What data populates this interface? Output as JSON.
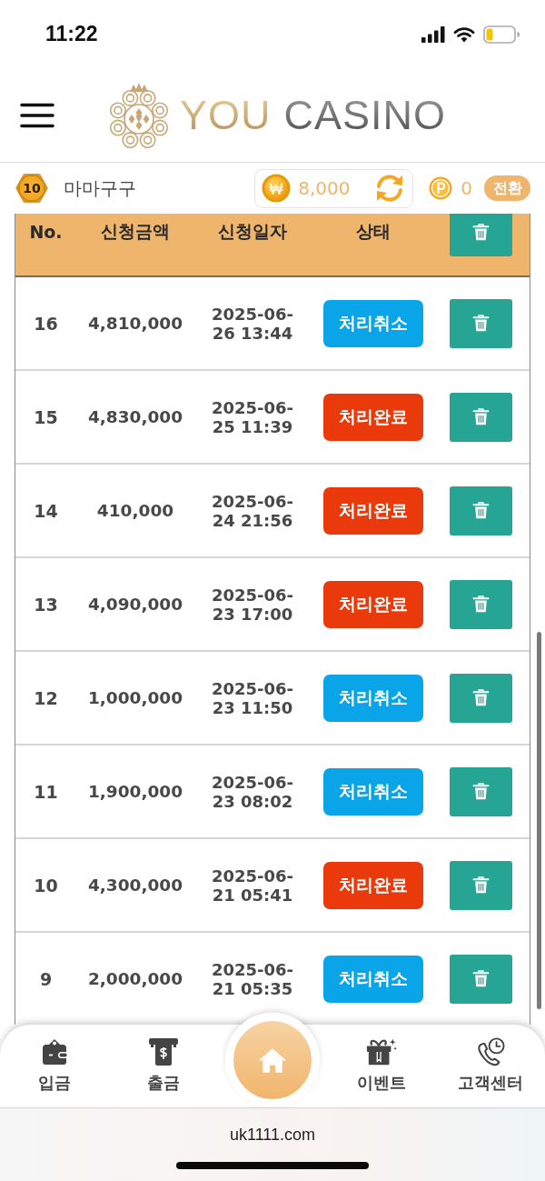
{
  "status_bar": {
    "time": "11:22"
  },
  "header": {
    "logo": {
      "primary": "YOU",
      "secondary": "CASINO"
    }
  },
  "user_bar": {
    "level": "10",
    "username": "마마구구",
    "balance": "8,000",
    "points": "0",
    "convert_button": "전환"
  },
  "table": {
    "columns": [
      "No.",
      "신청금액",
      "신청일자",
      "상태"
    ],
    "rows": [
      {
        "no": "16",
        "amount": "4,810,000",
        "date": "2025-06-26 13:44",
        "status": {
          "label": "처리취소",
          "kind": "cancelled"
        }
      },
      {
        "no": "15",
        "amount": "4,830,000",
        "date": "2025-06-25 11:39",
        "status": {
          "label": "처리완료",
          "kind": "completed"
        }
      },
      {
        "no": "14",
        "amount": "410,000",
        "date": "2025-06-24 21:56",
        "status": {
          "label": "처리완료",
          "kind": "completed"
        }
      },
      {
        "no": "13",
        "amount": "4,090,000",
        "date": "2025-06-23 17:00",
        "status": {
          "label": "처리완료",
          "kind": "completed"
        }
      },
      {
        "no": "12",
        "amount": "1,000,000",
        "date": "2025-06-23 11:50",
        "status": {
          "label": "처리취소",
          "kind": "cancelled"
        }
      },
      {
        "no": "11",
        "amount": "1,900,000",
        "date": "2025-06-23 08:02",
        "status": {
          "label": "처리취소",
          "kind": "cancelled"
        }
      },
      {
        "no": "10",
        "amount": "4,300,000",
        "date": "2025-06-21 05:41",
        "status": {
          "label": "처리완료",
          "kind": "completed"
        }
      },
      {
        "no": "9",
        "amount": "2,000,000",
        "date": "2025-06-21 05:35",
        "status": {
          "label": "처리취소",
          "kind": "cancelled"
        }
      }
    ]
  },
  "bottom_nav": {
    "items": [
      {
        "kind": "wallet",
        "label": "입금"
      },
      {
        "kind": "withdraw",
        "label": "출금"
      },
      {
        "kind": "home"
      },
      {
        "kind": "gift",
        "label": "이벤트"
      },
      {
        "kind": "support",
        "label": "고객센터"
      }
    ]
  },
  "browser_bar": {
    "url": "uk1111.com"
  }
}
